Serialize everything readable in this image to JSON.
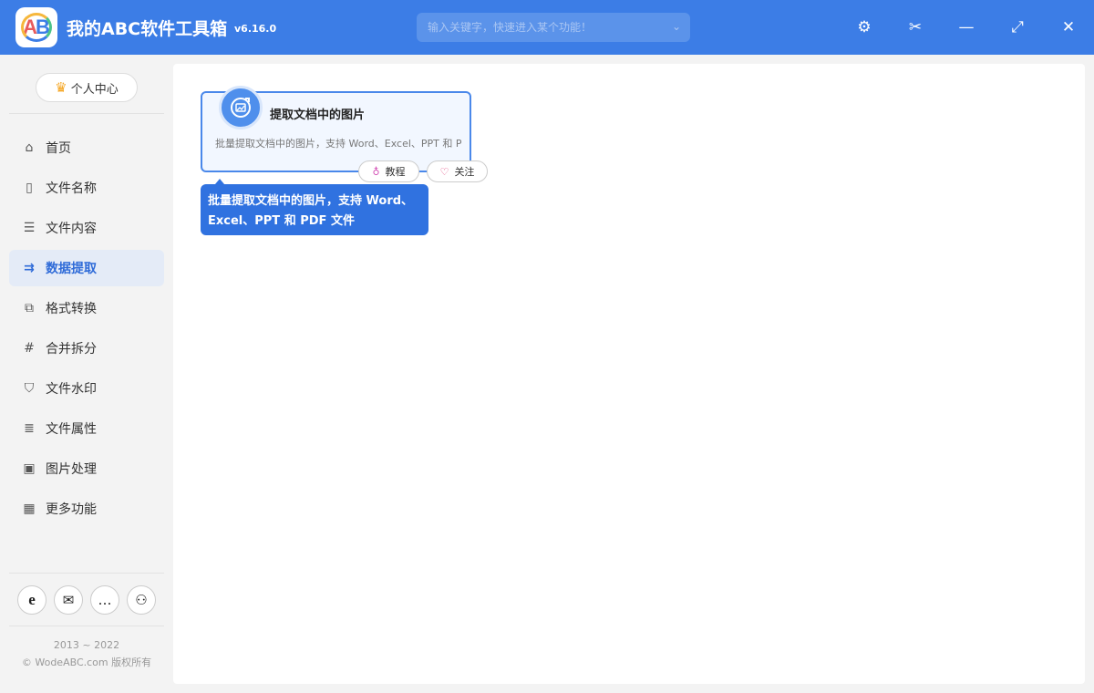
{
  "app": {
    "title": "我的ABC软件工具箱",
    "version": "v6.16.0",
    "logo_text_a": "A",
    "logo_text_b": "B"
  },
  "search": {
    "placeholder": "输入关键字，快速进入某个功能！"
  },
  "window_controls": [
    {
      "name": "settings",
      "glyph": "⚙"
    },
    {
      "name": "scissors",
      "glyph": "✂"
    },
    {
      "name": "minimize",
      "glyph": "—"
    },
    {
      "name": "maximize",
      "glyph": "⤢"
    },
    {
      "name": "close",
      "glyph": "✕"
    }
  ],
  "sidebar": {
    "personal_center": "个人中心",
    "items": [
      {
        "label": "首页",
        "icon": "home-icon",
        "glyph": "⌂",
        "active": false
      },
      {
        "label": "文件名称",
        "icon": "file-name-icon",
        "glyph": "▯",
        "active": false
      },
      {
        "label": "文件内容",
        "icon": "file-content-icon",
        "glyph": "☰",
        "active": false
      },
      {
        "label": "数据提取",
        "icon": "data-extract-icon",
        "glyph": "⇉",
        "active": true
      },
      {
        "label": "格式转换",
        "icon": "format-convert-icon",
        "glyph": "⧉",
        "active": false
      },
      {
        "label": "合并拆分",
        "icon": "merge-split-icon",
        "glyph": "#",
        "active": false
      },
      {
        "label": "文件水印",
        "icon": "watermark-icon",
        "glyph": "⛉",
        "active": false
      },
      {
        "label": "文件属性",
        "icon": "file-attribute-icon",
        "glyph": "≣",
        "active": false
      },
      {
        "label": "图片处理",
        "icon": "image-process-icon",
        "glyph": "▣",
        "active": false
      },
      {
        "label": "更多功能",
        "icon": "more-features-icon",
        "glyph": "▦",
        "active": false
      }
    ],
    "bottom_icons": [
      {
        "name": "browser-icon",
        "glyph": "e"
      },
      {
        "name": "mail-icon",
        "glyph": "✉"
      },
      {
        "name": "chat-icon",
        "glyph": "…"
      },
      {
        "name": "share-icon",
        "glyph": "⚇"
      }
    ],
    "copyright_years": "2013 ~ 2022",
    "copyright_text": "© WodeABC.com 版权所有"
  },
  "main": {
    "card": {
      "title": "提取文档中的图片",
      "description": "批量提取文档中的图片，支持 Word、Excel、PPT 和 PDF 文件"
    },
    "tutorial_label": "教程",
    "follow_label": "关注",
    "tooltip_line1": "批量提取文档中的图片，支持 Word、",
    "tooltip_line2": "Excel、PPT 和 PDF 文件"
  },
  "colors": {
    "accent": "#3c7de6",
    "active_bg": "#e4ebf7",
    "tooltip": "#3072e0"
  }
}
